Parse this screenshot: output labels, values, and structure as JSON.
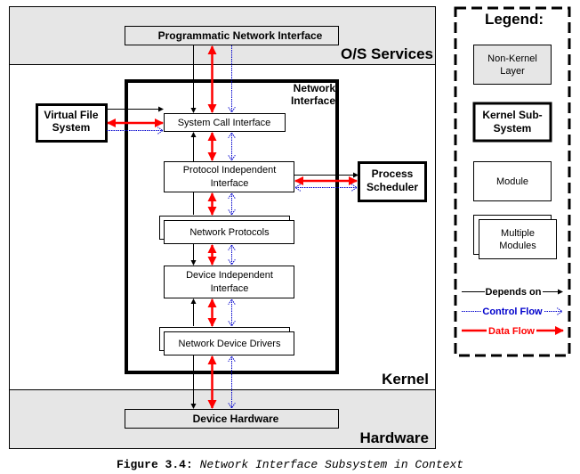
{
  "layers": {
    "os_services": "O/S Services",
    "kernel": "Kernel",
    "hardware": "Hardware"
  },
  "components": {
    "programmatic_network_interface": "Programmatic Network Interface",
    "network_interface_title": [
      "Network",
      "Interface"
    ],
    "virtual_file_system": [
      "Virtual File",
      "System"
    ],
    "system_call_interface": "System Call Interface",
    "protocol_independent_interface": [
      "Protocol Independent",
      "Interface"
    ],
    "process_scheduler": [
      "Process",
      "Scheduler"
    ],
    "network_protocols": "Network Protocols",
    "device_independent_interface": [
      "Device Independent",
      "Interface"
    ],
    "network_device_drivers": "Network Device Drivers",
    "device_hardware": "Device Hardware"
  },
  "legend": {
    "title": "Legend:",
    "non_kernel_layer": [
      "Non-Kernel",
      "Layer"
    ],
    "kernel_subsystem": [
      "Kernel Sub-",
      "System"
    ],
    "module": "Module",
    "multiple_modules": [
      "Multiple",
      "Modules"
    ],
    "depends_on": "Depends on",
    "control_flow": "Control Flow",
    "data_flow": "Data Flow"
  },
  "colors": {
    "layer_fill": "#e6e6e6",
    "depends_on": "#000000",
    "control_flow": "#0000cc",
    "data_flow": "#ff0000"
  },
  "caption": {
    "figure": "Figure 3.4:",
    "title": "Network Interface Subsystem in Context"
  }
}
